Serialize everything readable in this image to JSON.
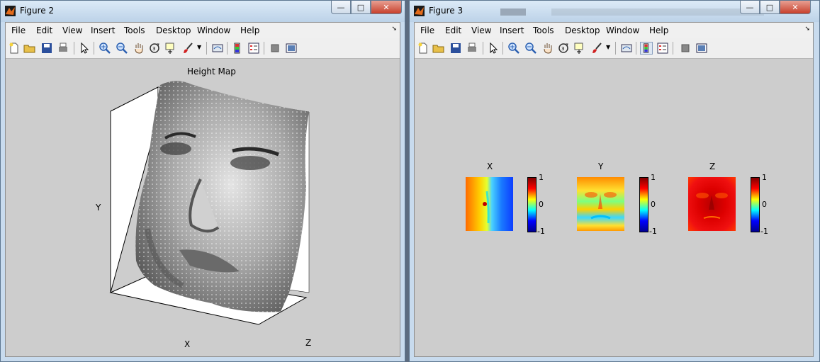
{
  "fig2": {
    "title": "Figure 2",
    "menu": [
      "File",
      "Edit",
      "View",
      "Insert",
      "Tools",
      "Desktop",
      "Window",
      "Help"
    ],
    "plot": {
      "title": "Height Map",
      "xlabel": "X",
      "ylabel": "Y",
      "zlabel": "Z"
    }
  },
  "fig3": {
    "title": "Figure 3",
    "menu": [
      "File",
      "Edit",
      "View",
      "Insert",
      "Tools",
      "Desktop",
      "Window",
      "Help"
    ],
    "panels": [
      {
        "title": "X",
        "cbar_ticks": [
          "1",
          "0",
          "-1"
        ]
      },
      {
        "title": "Y",
        "cbar_ticks": [
          "1",
          "0",
          "-1"
        ]
      },
      {
        "title": "Z",
        "cbar_ticks": [
          "1",
          "0",
          "-1"
        ]
      }
    ]
  },
  "controls": {
    "minimize": "—",
    "maximize": "□",
    "close": "✕"
  },
  "icons": [
    "new-file-icon",
    "open-folder-icon",
    "save-icon",
    "print-icon",
    "pointer-icon",
    "zoom-in-icon",
    "zoom-out-icon",
    "pan-hand-icon",
    "rotate-3d-icon",
    "data-cursor-icon",
    "brush-icon",
    "link-plot-icon",
    "colorbar-icon",
    "legend-icon",
    "hide-plot-tools-icon",
    "show-plot-tools-icon"
  ]
}
